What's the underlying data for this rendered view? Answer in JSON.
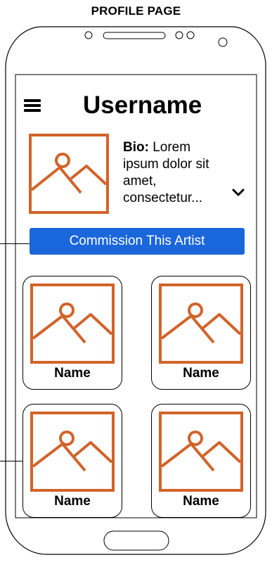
{
  "caption": "PROFILE PAGE",
  "header": {
    "username": "Username",
    "menu_icon": "hamburger-menu-icon"
  },
  "profile": {
    "image_icon": "image-placeholder-icon",
    "bio_label": "Bio:",
    "bio_lines": [
      " Lorem",
      "ipsum dolor sit",
      "amet,",
      "consectetur..."
    ],
    "expand_icon": "chevron-down-icon"
  },
  "commission_button": {
    "label": "Commission This Artist"
  },
  "gallery": {
    "items": [
      {
        "name": "Name"
      },
      {
        "name": "Name"
      },
      {
        "name": "Name"
      },
      {
        "name": "Name"
      }
    ]
  },
  "colors": {
    "accent_orange": "#d2632a",
    "button_blue": "#1a66db",
    "button_text": "#ffffff",
    "frame_stroke": "#000000"
  }
}
